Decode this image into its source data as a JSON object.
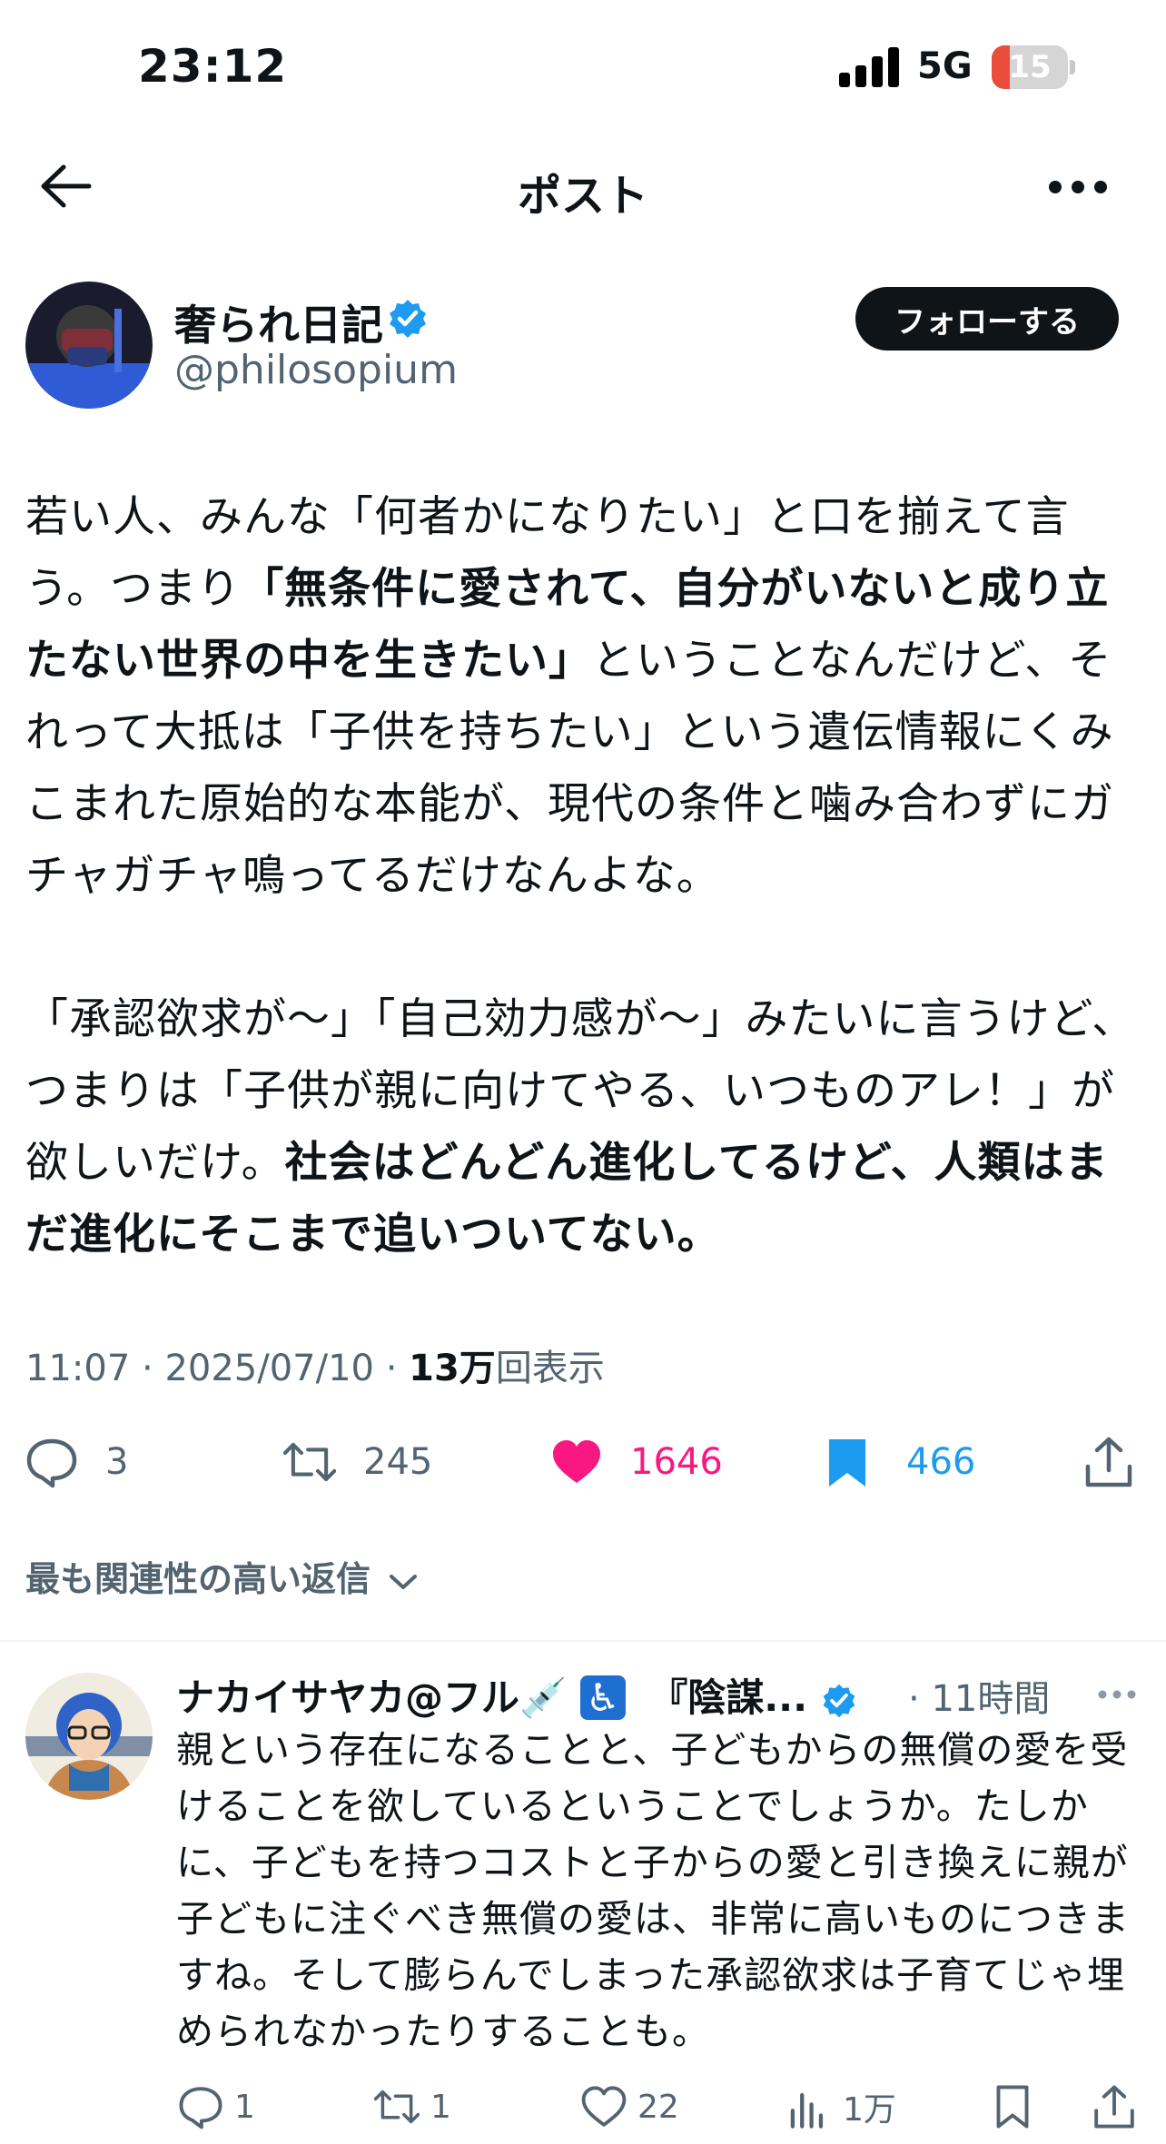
{
  "status_bar": {
    "time": "23:12",
    "network": "5G",
    "battery": "15"
  },
  "nav": {
    "title": "ポスト"
  },
  "author": {
    "name": "奢られ日記",
    "handle": "@philosopium",
    "follow_label": "フォローする"
  },
  "post": {
    "paragraphs": [
      [
        {
          "text": "若い人、みんな「何者かになりたい」と口を揃えて言う。つまり",
          "bold": false
        },
        {
          "text": "「無条件に愛されて、自分がいないと成り立たない世界の中を生きたい」",
          "bold": true
        },
        {
          "text": "ということなんだけど、それって大抵は「子供を持ちたい」という遺伝情報にくみこまれた原始的な本能が、現代の条件と噛み合わずにガチャガチャ鳴ってるだけなんよな。",
          "bold": false
        }
      ],
      [
        {
          "text": "「承認欲求が〜」「自己効力感が〜」みたいに言うけど、つまりは「子供が親に向けてやる、いつものアレ！」が欲しいだけ。",
          "bold": false
        },
        {
          "text": "社会はどんどん進化してるけど、人類はまだ進化にそこまで追いついてない。",
          "bold": true
        }
      ]
    ],
    "time": "11:07",
    "date": "2025/07/10",
    "views_count": "13万",
    "views_label": "回表示",
    "replies": "3",
    "reposts": "245",
    "likes": "1646",
    "bookmarks": "466"
  },
  "colors": {
    "like": "#f91880",
    "bookmark": "#1d9bf0",
    "verified": "#1d9bf0",
    "muted": "#536471"
  },
  "replies_section": {
    "sort_label": "最も関連性の高い返信"
  },
  "reply": {
    "name": "ナカイサヤカ@フル",
    "name_suffix": "『陰謀...",
    "emoji_1": "💉",
    "emoji_2": "♿",
    "time": "11時間",
    "text": "親という存在になることと、子どもからの無償の愛を受けることを欲しているということでしょうか。たしかに、子どもを持つコストと子からの愛と引き換えに親が子どもに注ぐべき無償の愛は、非常に高いものにつきますね。そして膨らんでしまった承認欲求は子育てじゃ埋められなかったりすることも。",
    "replies": "1",
    "reposts": "1",
    "likes": "22",
    "views": "1万"
  }
}
